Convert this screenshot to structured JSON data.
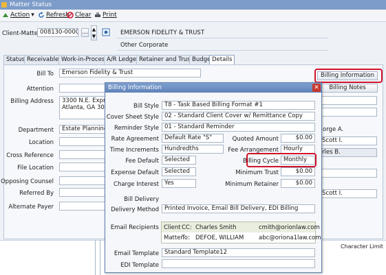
{
  "window": {
    "title": "Matter Status"
  },
  "toolbar": {
    "action": "Action",
    "refresh": "Refresh",
    "clear": "Clear",
    "print": "Print"
  },
  "client_matter": {
    "label": "Client-Matter",
    "value": "008130-000002",
    "name": "EMERSON FIDELITY & TRUST",
    "type": "Other Corporate"
  },
  "tabs": [
    "Status",
    "Receivables",
    "Work-in-Process",
    "A/R Ledger",
    "Retainer and Trust",
    "Budget",
    "Details"
  ],
  "details": {
    "bill_to_label": "Bill To",
    "bill_to_value": "Emerson Fidelity & Trust",
    "attention_label": "Attention",
    "billing_address_label": "Billing Address",
    "billing_address_line1": "3300 N.E. Express",
    "billing_address_line2": "Atlanta, GA 30341",
    "department_label": "Department",
    "department_value": "Estate Planning",
    "location_label": "Location",
    "cross_reference_label": "Cross Reference",
    "file_location_label": "File Location",
    "opposing_counsel_label": "Opposing Counsel",
    "referred_by_label": "Referred By",
    "alternate_payer_label": "Alternate Payer",
    "billing_information_button": "Billing Information",
    "billing_notes_button": "Billing Notes",
    "right_col": [
      "orge A.",
      "Scott I.",
      "rles B.",
      "Scott I."
    ],
    "character_limit": "Character Limit"
  },
  "dialog": {
    "title": "Billing Information",
    "bill_style_label": "Bill Style",
    "bill_style_value": "T8 - Task Based Billing Format #1",
    "cover_sheet_label": "Cover Sheet Style",
    "cover_sheet_value": "02 - Standard Client Cover w/ Remittance Copy",
    "reminder_label": "Reminder Style",
    "reminder_value": "01 - Standard Reminder",
    "rate_agreement_label": "Rate Agreement",
    "rate_agreement_value": "Default Rate \"S\"",
    "quoted_amount_label": "Quoted Amount",
    "quoted_amount_value": "$0.00",
    "time_increments_label": "Time Increments",
    "time_increments_value": "Hundredths",
    "fee_arrangement_label": "Fee Arrangement",
    "fee_arrangement_value": "Hourly",
    "fee_default_label": "Fee Default",
    "fee_default_value": "Selected",
    "billing_cycle_label": "Billing Cycle",
    "billing_cycle_value": "Monthly",
    "expense_default_label": "Expense Default",
    "expense_default_value": "Selected",
    "minimum_trust_label": "Minimum Trust",
    "minimum_trust_value": "$0.00",
    "charge_interest_label": "Charge Interest",
    "charge_interest_value": "Yes",
    "minimum_retainer_label": "Minimum Retainer",
    "minimum_retainer_value": "$0.00",
    "bill_delivery_label": "Bill Delivery",
    "delivery_method_label": "Delivery Method",
    "delivery_method_value": "Printed Invoice, Email Bill Delivery, EDI Billing",
    "email_recipients_label": "Email Recipients",
    "recipients": [
      {
        "who": "Client",
        "cc": "CC:",
        "name": "Charles Smith",
        "email": "cmith@orionlaw.com"
      },
      {
        "who": "Matter",
        "cc": "To:",
        "name": "DEFOE, WILLIAM",
        "email": "abc@oriona1law.com"
      }
    ],
    "email_template_label": "Email Template",
    "email_template_value": "Standard Template12",
    "edi_template_label": "EDI Template"
  },
  "colors": {
    "highlight": "#d0122a",
    "title_bar": "#7d9cc9"
  }
}
